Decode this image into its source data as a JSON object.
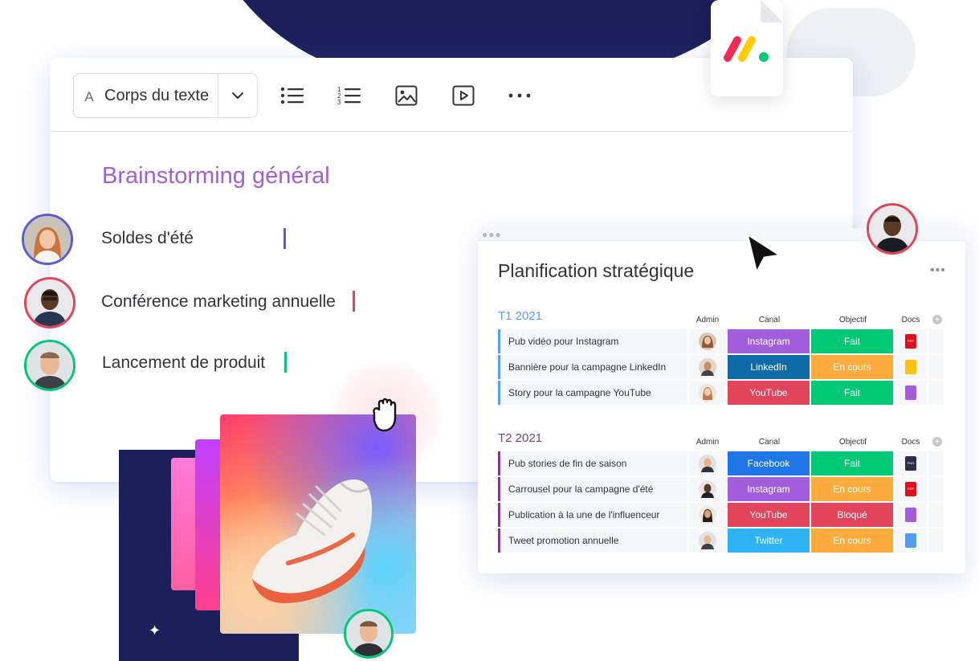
{
  "toolbar": {
    "font_prefix": "A",
    "font_label": "Corps du texte",
    "icons": [
      "chevron-down-icon",
      "bullet-list-icon",
      "numbered-list-icon",
      "image-icon",
      "video-icon",
      "more-icon"
    ]
  },
  "document": {
    "title": "Brainstorming général",
    "lines": [
      {
        "text": "Soldes d'été",
        "caret_color": "#5b5ccf",
        "avatar_ring": "#5b5ccf"
      },
      {
        "text": "Conférence marketing annuelle",
        "caret_color": "#e2445c",
        "avatar_ring": "#e2445c"
      },
      {
        "text": "Lancement de produit",
        "caret_color": "#00c875",
        "avatar_ring": "#00c875"
      }
    ]
  },
  "planning": {
    "title": "Planification stratégique",
    "columns": {
      "admin": "Admin",
      "canal": "Canal",
      "objectif": "Objectif",
      "docs": "Docs"
    },
    "groups": [
      {
        "title": "T1 2021",
        "color": "#579bfc",
        "rows": [
          {
            "task": "Pub vidéo pour Instagram",
            "canal": "Instagram",
            "canal_color": "#a25ddc",
            "objectif": "Fait",
            "objectif_color": "#00c875",
            "doc": "pdf-icon"
          },
          {
            "task": "Bannière pour la campagne LinkedIn",
            "canal": "LinkedIn",
            "canal_color": "#0f6ba8",
            "objectif": "En cours",
            "objectif_color": "#fdab3d",
            "doc": "zip-icon"
          },
          {
            "task": "Story pour la campagne YouTube",
            "canal": "YouTube",
            "canal_color": "#e2445c",
            "objectif": "Fait",
            "objectif_color": "#00c875",
            "doc": "video-file-icon"
          }
        ]
      },
      {
        "title": "T2 2021",
        "color": "#7e3b8a",
        "rows": [
          {
            "task": "Pub stories de fin de saison",
            "canal": "Facebook",
            "canal_color": "#1f76e6",
            "objectif": "Fait",
            "objectif_color": "#00c875",
            "doc": "png-icon"
          },
          {
            "task": "Carrousel pour la campagne d'été",
            "canal": "Instagram",
            "canal_color": "#a25ddc",
            "objectif": "En cours",
            "objectif_color": "#fdab3d",
            "doc": "pdf-icon"
          },
          {
            "task": "Publication à la une de l'influenceur",
            "canal": "YouTube",
            "canal_color": "#e2445c",
            "objectif": "Bloqué",
            "objectif_color": "#e2445c",
            "doc": "video-file-icon"
          },
          {
            "task": "Tweet promotion annuelle",
            "canal": "Twitter",
            "canal_color": "#2db3f6",
            "objectif": "En cours",
            "objectif_color": "#fdab3d",
            "doc": "image-file-icon"
          }
        ]
      }
    ]
  },
  "doc_labels": {
    "pdf": "PDF",
    "png": "PNG"
  },
  "brand_colors": {
    "red": "#f62b54",
    "yellow": "#ffcc00",
    "green": "#00ca72",
    "navy": "#1c1f5a"
  }
}
